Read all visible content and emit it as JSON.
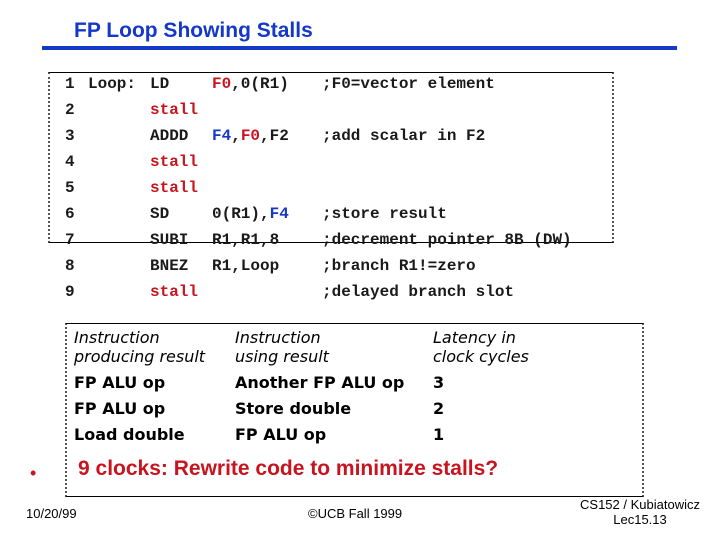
{
  "slide": {
    "title": "FP Loop Showing Stalls",
    "code": [
      {
        "num": "1",
        "label": "Loop:",
        "op": "LD",
        "args": [
          {
            "t": "F0",
            "c": "red"
          },
          {
            "t": ",0(R1)",
            "c": ""
          }
        ],
        "comment": ";F0=vector element",
        "op_color": ""
      },
      {
        "num": "2",
        "label": "",
        "op": "stall",
        "args": [],
        "comment": "",
        "op_color": "red"
      },
      {
        "num": "3",
        "label": "",
        "op": "ADDD",
        "args": [
          {
            "t": "F4",
            "c": "blue"
          },
          {
            "t": ",",
            "c": ""
          },
          {
            "t": "F0",
            "c": "red"
          },
          {
            "t": ",F2",
            "c": ""
          }
        ],
        "comment": ";add scalar in F2",
        "op_color": ""
      },
      {
        "num": "4",
        "label": "",
        "op": "stall",
        "args": [],
        "comment": "",
        "op_color": "red"
      },
      {
        "num": "5",
        "label": "",
        "op": "stall",
        "args": [],
        "comment": "",
        "op_color": "red"
      },
      {
        "num": "6",
        "label": "",
        "op": "SD",
        "args": [
          {
            "t": "0(R1),",
            "c": ""
          },
          {
            "t": "F4",
            "c": "blue"
          }
        ],
        "comment": ";store result",
        "op_color": ""
      },
      {
        "num": "7",
        "label": "",
        "op": "SUBI",
        "args": [
          {
            "t": "R1,R1,8",
            "c": ""
          }
        ],
        "comment": ";decrement pointer 8B (DW)",
        "op_color": ""
      },
      {
        "num": "8",
        "label": "",
        "op": "BNEZ",
        "args": [
          {
            "t": "R1,Loop",
            "c": ""
          }
        ],
        "comment": ";branch R1!=zero",
        "op_color": ""
      },
      {
        "num": "9",
        "label": "",
        "op": "stall",
        "args": [],
        "comment": ";delayed branch slot",
        "op_color": "red"
      }
    ],
    "latency_table": {
      "headers": [
        "Instruction\nproducing result",
        "Instruction\nusing result",
        "Latency in\nclock cycles"
      ],
      "header_lines": [
        [
          "Instruction",
          "producing result"
        ],
        [
          "Instruction",
          "using result"
        ],
        [
          "Latency in",
          "clock cycles"
        ]
      ],
      "rows": [
        [
          "FP ALU op",
          "Another FP ALU op",
          "3"
        ],
        [
          "FP ALU op",
          "Store double",
          "2"
        ],
        [
          "Load double",
          "FP ALU op",
          "1"
        ]
      ]
    },
    "bullet": "9 clocks: Rewrite code to minimize stalls?",
    "bullet_marker": "•",
    "footer": {
      "date": "10/20/99",
      "copyright": "©UCB Fall 1999",
      "course": "CS152 / Kubiatowicz",
      "lecture": "Lec15.13"
    },
    "colors": {
      "title": "#1438c8",
      "highlight_red": "#c8141e",
      "highlight_blue": "#1438c8"
    }
  }
}
